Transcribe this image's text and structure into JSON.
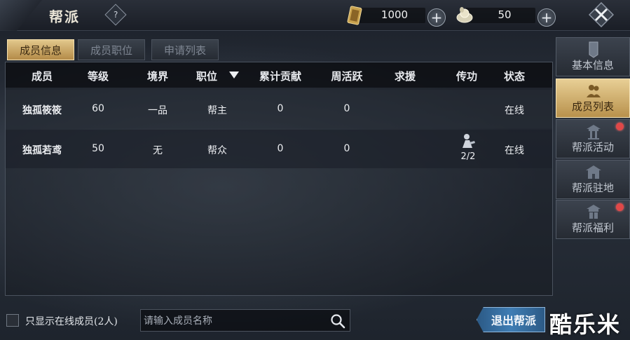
{
  "header": {
    "title": "帮派",
    "help_label": "?",
    "currency": [
      {
        "icon": "scroll-ticket-icon",
        "value": "1000"
      },
      {
        "icon": "silver-ingot-icon",
        "value": "50"
      }
    ]
  },
  "tabs": [
    {
      "label": "成员信息",
      "active": true
    },
    {
      "label": "成员职位",
      "active": false
    },
    {
      "label": "申请列表",
      "active": false
    }
  ],
  "table": {
    "columns": [
      "成员",
      "等级",
      "境界",
      "职位",
      "累计贡献",
      "周活跃",
      "求援",
      "传功",
      "状态"
    ],
    "rows": [
      {
        "name": "独孤筱筱",
        "level": "60",
        "realm": "一品",
        "position": "帮主",
        "contribution": "0",
        "weekly_active": "0",
        "help": "",
        "transmit": "",
        "status": "在线"
      },
      {
        "name": "独孤若鸢",
        "level": "50",
        "realm": "无",
        "position": "帮众",
        "contribution": "0",
        "weekly_active": "0",
        "help": "",
        "transmit": "2/2",
        "status": "在线"
      }
    ]
  },
  "side_menu": [
    {
      "label": "基本信息",
      "icon": "banner-icon",
      "active": false,
      "badge": false
    },
    {
      "label": "成员列表",
      "icon": "members-icon",
      "active": true,
      "badge": false
    },
    {
      "label": "帮派活动",
      "icon": "pavilion-icon",
      "active": false,
      "badge": true
    },
    {
      "label": "帮派驻地",
      "icon": "palace-icon",
      "active": false,
      "badge": false
    },
    {
      "label": "帮派福利",
      "icon": "gift-pavilion-icon",
      "active": false,
      "badge": true
    }
  ],
  "footer": {
    "online_only_label": "只显示在线成员(2人)",
    "online_only_checked": false,
    "search_placeholder": "请输入成员名称",
    "search_value": "",
    "exit_label": "退出帮派"
  },
  "watermark": "酷乐米",
  "colors": {
    "accent_gold": "#d8b56e",
    "accent_blue": "#3f7db4",
    "badge_red": "#e04848"
  }
}
